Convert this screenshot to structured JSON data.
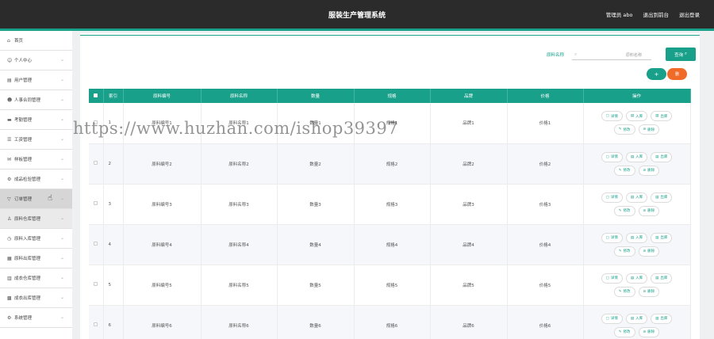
{
  "header": {
    "title": "服装生产管理系统",
    "user_label": "管理员 abo",
    "back_label": "退出到前台",
    "logout_label": "退出登录"
  },
  "sidebar": {
    "items": [
      {
        "icon": "home-icon",
        "label": "首页",
        "has_children": false
      },
      {
        "icon": "user-icon",
        "label": "个人中心",
        "has_children": true
      },
      {
        "icon": "users-icon",
        "label": "用户管理",
        "has_children": true
      },
      {
        "icon": "hr-icon",
        "label": "人事合同管理",
        "has_children": true
      },
      {
        "icon": "chat-icon",
        "label": "考勤管理",
        "has_children": true
      },
      {
        "icon": "list-icon",
        "label": "工资管理",
        "has_children": true
      },
      {
        "icon": "mail-icon",
        "label": "样板管理",
        "has_children": true
      },
      {
        "icon": "gear-icon",
        "label": "成品检验管理",
        "has_children": true
      },
      {
        "icon": "cup-icon",
        "label": "订单管理",
        "has_children": true
      },
      {
        "icon": "person-icon",
        "label": "原料仓库管理",
        "has_children": true
      },
      {
        "icon": "clock-icon",
        "label": "原料入库管理",
        "has_children": true
      },
      {
        "icon": "doc-icon",
        "label": "原料出库管理",
        "has_children": true
      },
      {
        "icon": "chart-icon",
        "label": "成衣仓库管理",
        "has_children": true
      },
      {
        "icon": "grid-icon",
        "label": "成衣出库管理",
        "has_children": true
      },
      {
        "icon": "cog-icon",
        "label": "系统管理",
        "has_children": true
      }
    ]
  },
  "search": {
    "label": "原料名称",
    "placeholder": "原料名称",
    "button": "查询"
  },
  "actions": {
    "add": "+",
    "delete": "删"
  },
  "table": {
    "headers": [
      "",
      "索引",
      "原料编号",
      "原料名称",
      "数量",
      "规格",
      "品牌",
      "价格",
      "操作"
    ],
    "rows": [
      {
        "index": "1",
        "code": "原料编号1",
        "name": "原料名称1",
        "qty": "数量1",
        "spec": "规格1",
        "brand": "品牌1",
        "price": "价格1"
      },
      {
        "index": "2",
        "code": "原料编号2",
        "name": "原料名称2",
        "qty": "数量2",
        "spec": "规格2",
        "brand": "品牌2",
        "price": "价格2"
      },
      {
        "index": "3",
        "code": "原料编号3",
        "name": "原料名称3",
        "qty": "数量3",
        "spec": "规格3",
        "brand": "品牌3",
        "price": "价格3"
      },
      {
        "index": "4",
        "code": "原料编号4",
        "name": "原料名称4",
        "qty": "数量4",
        "spec": "规格4",
        "brand": "品牌4",
        "price": "价格4"
      },
      {
        "index": "5",
        "code": "原料编号5",
        "name": "原料名称5",
        "qty": "数量5",
        "spec": "规格5",
        "brand": "品牌5",
        "price": "价格5"
      },
      {
        "index": "6",
        "code": "原料编号6",
        "name": "原料名称6",
        "qty": "数量6",
        "spec": "规格6",
        "brand": "品牌6",
        "price": "价格6"
      }
    ],
    "row_buttons": [
      "详情",
      "入库",
      "出库",
      "修改",
      "删除"
    ]
  },
  "watermark": "https://www.huzhan.com/ishop39397",
  "colors": {
    "accent": "#18a08a",
    "danger": "#f06a28",
    "header_bg": "#2b2b2b"
  }
}
